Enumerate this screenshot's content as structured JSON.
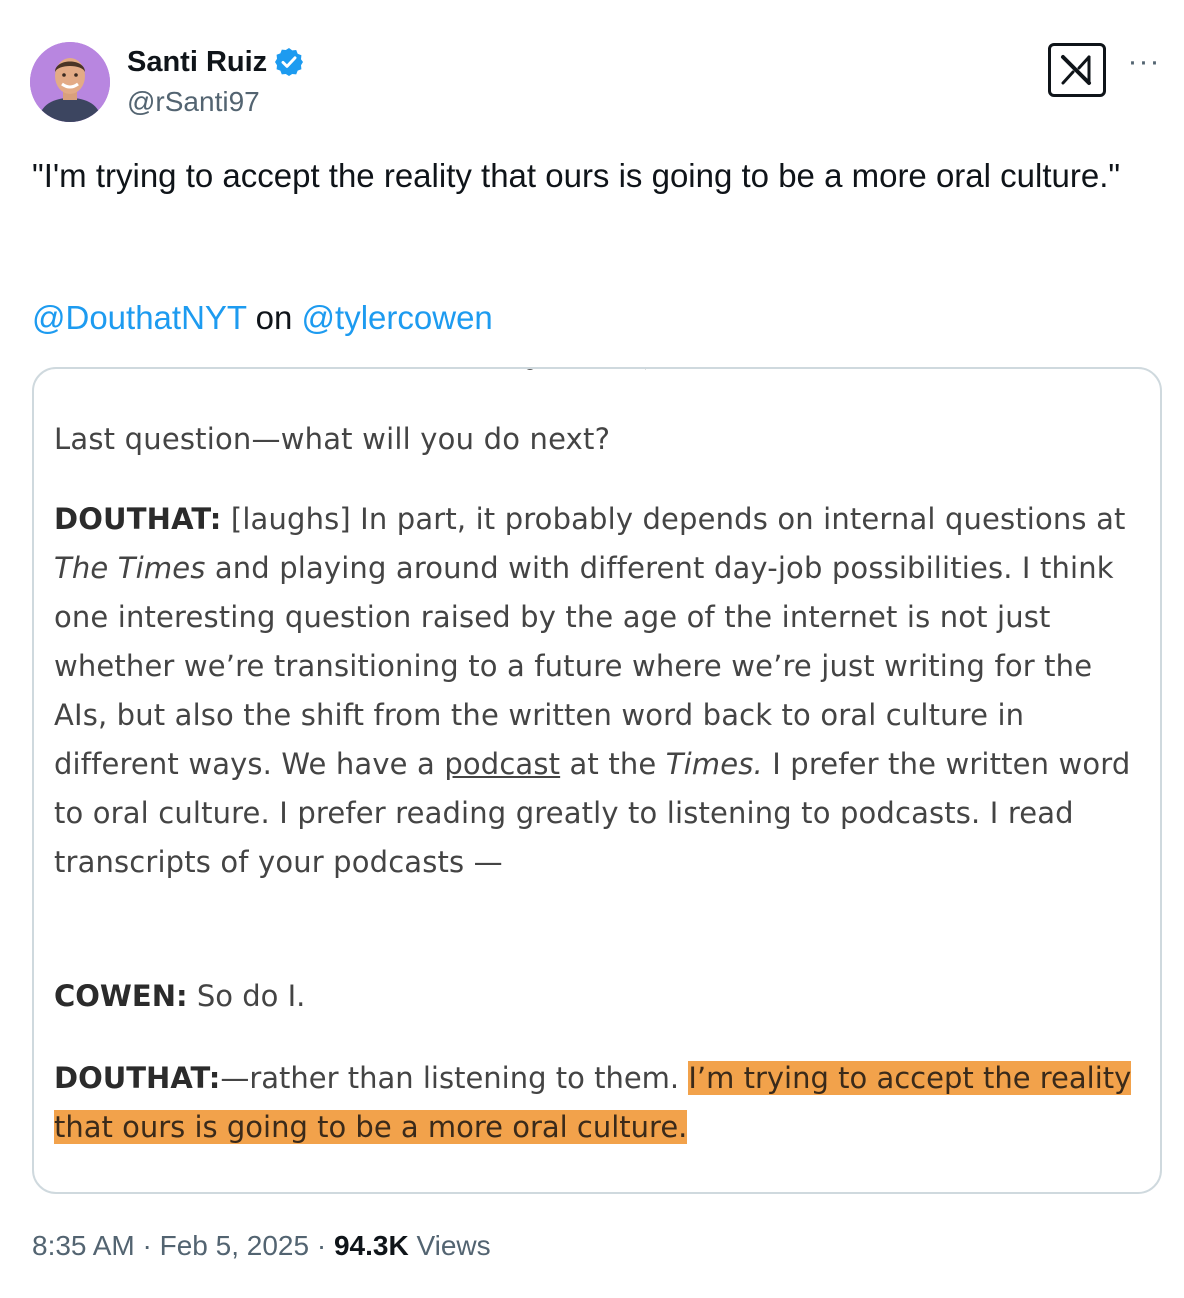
{
  "author": {
    "name": "Santi Ruiz",
    "handle": "@rSanti97"
  },
  "tweet": {
    "text": "\"I'm trying to accept the reality that ours is going to be a more oral culture.\"",
    "mention1": "@DouthatNYT",
    "connector": "on",
    "mention2": "@tylercowen"
  },
  "excerpt": {
    "question": "Last question—what will you do next?",
    "p1_speaker": "DOUTHAT:",
    "p1_a": " [laughs] In part, it probably depends on internal questions at ",
    "p1_the_times": "The Times",
    "p1_b": " and playing around with different day-job possibilities. I think one interesting question raised by the age of the internet is not just whether we’re transitioning to a future where we’re just writing for the AIs, but also the shift from the written word back to oral culture in different ways. We have a ",
    "p1_podcast": "podcast",
    "p1_c": " at the ",
    "p1_times": "Times.",
    "p1_d": " I prefer the written word to oral culture. I prefer reading greatly to listening to podcasts. I read transcripts of your podcasts —",
    "p2_speaker": "COWEN:",
    "p2_text": " So do I.",
    "p3_speaker": "DOUTHAT:",
    "p3_text": "—rather than listening to them. ",
    "p3_highlight": "I’m trying to accept the reality that ours is going to be a more oral culture."
  },
  "meta": {
    "time": "8:35 AM",
    "sep1": " · ",
    "date": "Feb 5, 2025",
    "sep2": " · ",
    "views_count": "94.3K",
    "views_label": " Views"
  },
  "colors": {
    "link": "#1d9bf0",
    "highlight": "#f2a24b",
    "avatar_bg": "#b886e0",
    "verified": "#1d9bf0"
  },
  "icons": [
    "verified-badge-icon",
    "x-logo-icon",
    "more-options-icon"
  ]
}
